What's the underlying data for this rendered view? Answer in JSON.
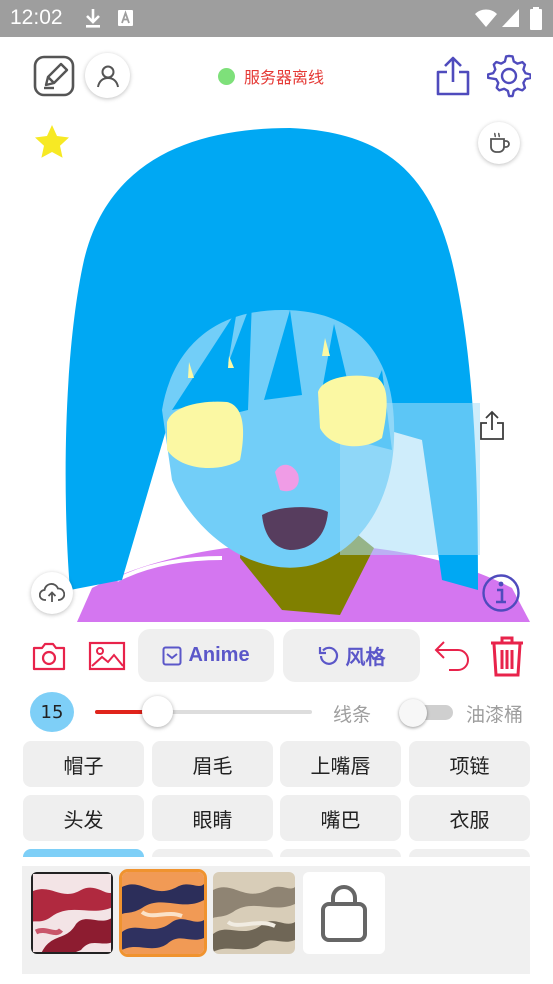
{
  "status_bar": {
    "time": "12:02",
    "icons": [
      "download-icon",
      "font-icon",
      "wifi-icon",
      "signal-icon",
      "battery-icon"
    ]
  },
  "header": {
    "server_status": "服务器离线",
    "server_status_color": "#7ee07a",
    "icons": [
      "edit-canvas-icon",
      "user-icon",
      "share-icon",
      "settings-icon"
    ]
  },
  "canvas": {
    "icons": [
      "star-icon",
      "coffee-icon",
      "export-icon",
      "cloud-upload-icon",
      "info-icon"
    ]
  },
  "toolbar": {
    "anime_label": "Anime",
    "style_label": "风格",
    "icons": [
      "camera-icon",
      "image-icon",
      "checkbox-icon",
      "refresh-icon",
      "undo-icon",
      "trash-icon"
    ]
  },
  "brush": {
    "size": "15",
    "level": 0.29,
    "line_label": "线条",
    "bucket_label": "油漆桶",
    "bucket_enabled": false
  },
  "parts": {
    "row1": [
      "帽子",
      "眉毛",
      "上嘴唇",
      "项链"
    ],
    "row2": [
      "头发",
      "眼睛",
      "嘴巴",
      "衣服"
    ]
  },
  "styles": {
    "selected_index": 1,
    "accent_color": "#f0932f",
    "shop_icon": "shopping-bag-icon"
  },
  "colors": {
    "primary": "#5b57c9",
    "danger": "#e8234b",
    "hair": "#00a8f3",
    "skin": "#72cef8",
    "clothes": "#d476f0"
  }
}
